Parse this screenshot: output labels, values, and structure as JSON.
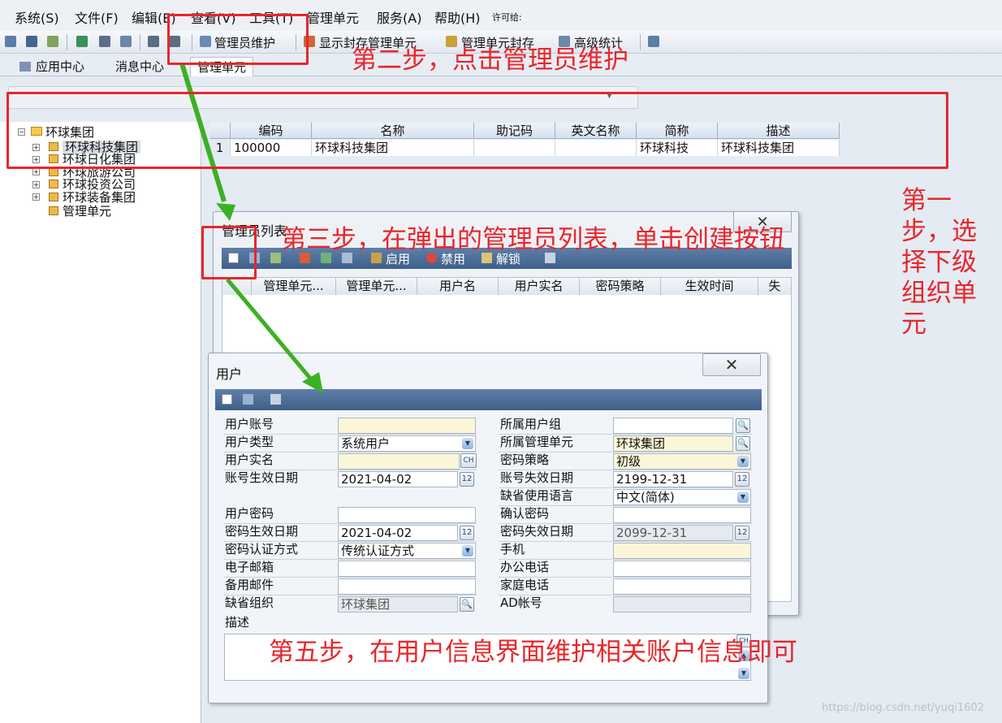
{
  "menu": {
    "items": [
      "系统(S)",
      "文件(F)",
      "编辑(E)",
      "查看(V)",
      "工具(T)",
      "管理单元",
      "服务(A)",
      "帮助(H)"
    ],
    "license": "许可给:"
  },
  "toolbar": {
    "admin_maintain": "管理员维护",
    "show_sealed": "显示封存管理单元",
    "seal": "管理单元封存",
    "advanced_stats": "高级统计"
  },
  "tabs": [
    "应用中心",
    "消息中心",
    "管理单元"
  ],
  "tree": {
    "root": "环球集团",
    "children": [
      "环球科技集团",
      "环球日化集团",
      "环球旅游公司",
      "环球投资公司",
      "环球装备集团",
      "管理单元"
    ]
  },
  "grid": {
    "headers": [
      "编码",
      "名称",
      "助记码",
      "英文名称",
      "简称",
      "描述"
    ],
    "rows": [
      {
        "index": "1",
        "code": "100000",
        "name": "环球科技集团",
        "mnemonic": "",
        "english": "",
        "short": "环球科技",
        "desc": "环球科技集团"
      }
    ]
  },
  "admin_list": {
    "title": "管理员列表",
    "tool_labels": {
      "enable": "启用",
      "disable": "禁用",
      "unlock": "解锁"
    },
    "columns": [
      "管理单元...",
      "管理单元...",
      "用户名",
      "用户实名",
      "密码策略",
      "生效时间",
      "失"
    ]
  },
  "user_dialog": {
    "title": "用户",
    "left": [
      {
        "label": "用户账号",
        "value": ""
      },
      {
        "label": "用户类型",
        "value": "系统用户"
      },
      {
        "label": "用户实名",
        "value": ""
      },
      {
        "label": "账号生效日期",
        "value": "2021-04-02"
      },
      {
        "label": "用户密码",
        "value": ""
      },
      {
        "label": "密码生效日期",
        "value": "2021-04-02"
      },
      {
        "label": "密码认证方式",
        "value": "传统认证方式"
      },
      {
        "label": "电子邮箱",
        "value": ""
      },
      {
        "label": "备用邮件",
        "value": ""
      },
      {
        "label": "缺省组织",
        "value": "环球集团"
      }
    ],
    "right": [
      {
        "label": "所属用户组",
        "value": ""
      },
      {
        "label": "所属管理单元",
        "value": "环球集团"
      },
      {
        "label": "密码策略",
        "value": "初级"
      },
      {
        "label": "账号失效日期",
        "value": "2199-12-31"
      },
      {
        "label": "缺省使用语言",
        "value": "中文(简体)"
      },
      {
        "label": "确认密码",
        "value": ""
      },
      {
        "label": "密码失效日期",
        "value": "2099-12-31"
      },
      {
        "label": "手机",
        "value": ""
      },
      {
        "label": "办公电话",
        "value": ""
      },
      {
        "label": "家庭电话",
        "value": ""
      },
      {
        "label": "AD帐号",
        "value": ""
      }
    ],
    "desc_label": "描述",
    "ime_badge": "CH"
  },
  "annotations": {
    "step1": "第一步，选择下级组织单元",
    "step2": "第二步，点击管理员维护",
    "step3": "第三步，在弹出的管理员列表，单击创建按钮",
    "step5": "第五步，在用户信息界面维护相关账户信息即可"
  },
  "watermark": "https://blog.csdn.net/yuqi1602",
  "colors": {
    "annotation": "#e8262b",
    "arrow": "#3cb023",
    "toolbar_blue": "#4a6b95"
  }
}
